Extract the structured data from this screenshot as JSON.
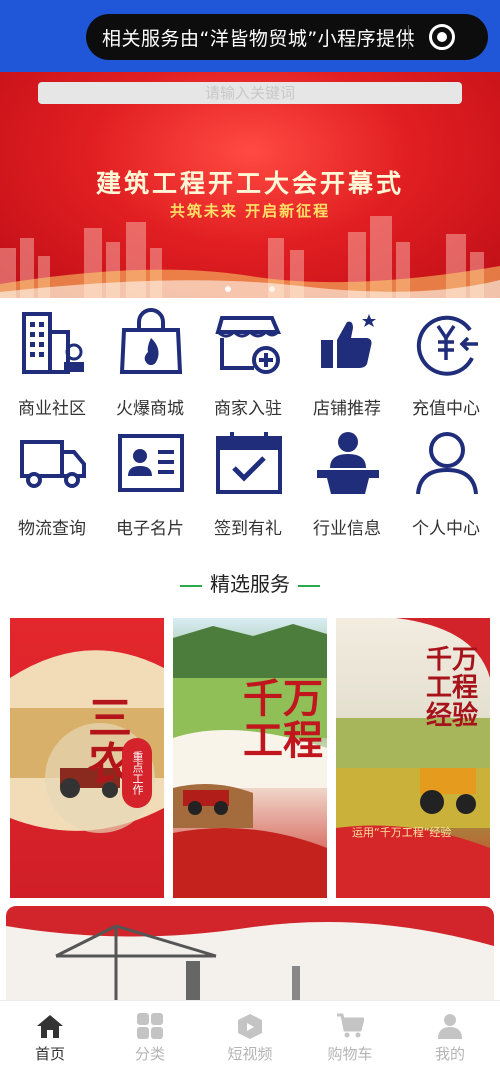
{
  "capsule": {
    "text": "相关服务由“洋皆物贸城”小程序提供"
  },
  "search": {
    "placeholder": "请输入关键词"
  },
  "banner": {
    "title": "建筑工程开工大会开幕式",
    "subtitle": "共筑未来  开启新征程"
  },
  "grid": [
    {
      "label": "商业社区",
      "icon": "building-icon"
    },
    {
      "label": "火爆商城",
      "icon": "fire-bag-icon"
    },
    {
      "label": "商家入驻",
      "icon": "store-add-icon"
    },
    {
      "label": "店铺推荐",
      "icon": "thumbs-up-icon"
    },
    {
      "label": "充值中心",
      "icon": "yen-icon"
    },
    {
      "label": "物流查询",
      "icon": "truck-icon"
    },
    {
      "label": "电子名片",
      "icon": "id-card-icon"
    },
    {
      "label": "签到有礼",
      "icon": "calendar-check-icon"
    },
    {
      "label": "行业信息",
      "icon": "speaker-icon"
    },
    {
      "label": "个人中心",
      "icon": "user-icon"
    }
  ],
  "section": {
    "title": "精选服务"
  },
  "cards": [
    {
      "big_text": "三农",
      "side_text": "重点工作"
    },
    {
      "big_text": "千万工程"
    },
    {
      "big_text": "千万工程经验",
      "bottom_text": "运用“千万工程”经验"
    }
  ],
  "tabs": [
    {
      "label": "首页",
      "icon": "home-icon",
      "active": true
    },
    {
      "label": "分类",
      "icon": "grid-icon"
    },
    {
      "label": "短视频",
      "icon": "video-box-icon"
    },
    {
      "label": "购物车",
      "icon": "cart-icon"
    },
    {
      "label": "我的",
      "icon": "person-icon"
    }
  ],
  "colors": {
    "brand_blue": "#1f57d8",
    "icon_navy": "#1f2d7a",
    "banner_red": "#e11f22",
    "section_line": "#2aa84a"
  }
}
